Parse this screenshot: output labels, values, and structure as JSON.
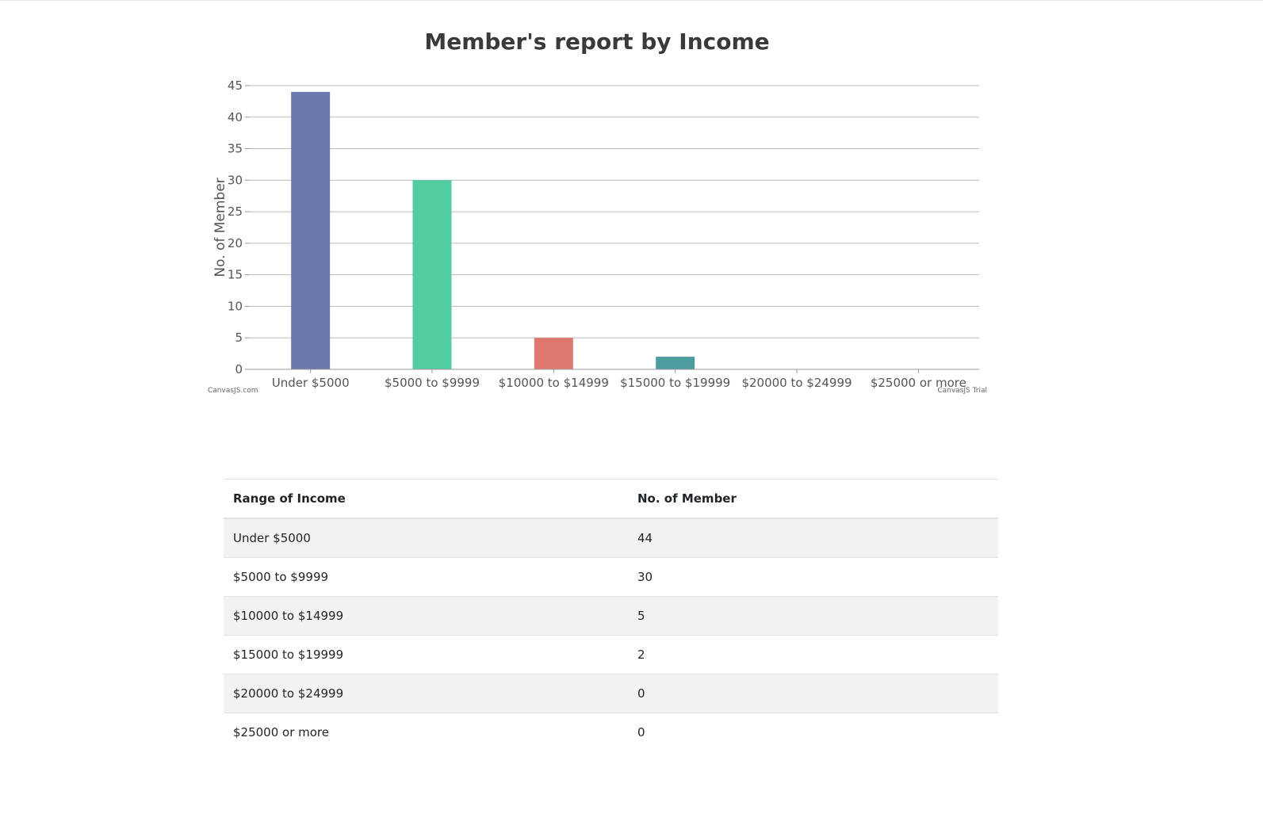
{
  "chart_data": {
    "type": "bar",
    "title": "Member's report by Income",
    "ylabel": "No. of Member",
    "xlabel": "",
    "categories": [
      "Under $5000",
      "$5000 to $9999",
      "$10000 to $14999",
      "$15000 to $19999",
      "$20000 to $24999",
      "$25000 or more"
    ],
    "values": [
      44,
      30,
      5,
      2,
      0,
      0
    ],
    "colors": [
      "#6d78ad",
      "#51cda0",
      "#df7970",
      "#4c9ca0",
      "#ae7d99",
      "#c9d45c"
    ],
    "ylim": [
      0,
      45
    ],
    "yticks": [
      0,
      5,
      10,
      15,
      20,
      25,
      30,
      35,
      40,
      45
    ],
    "grid": true,
    "grid_color": "#bbbbbb",
    "credit_left": "CanvasJS.com",
    "credit_right": "CanvasJS Trial"
  },
  "table": {
    "headers": [
      "Range of Income",
      "No. of Member"
    ],
    "rows": [
      [
        "Under $5000",
        "44"
      ],
      [
        "$5000 to $9999",
        "30"
      ],
      [
        "$10000 to $14999",
        "5"
      ],
      [
        "$15000 to $19999",
        "2"
      ],
      [
        "$20000 to $24999",
        "0"
      ],
      [
        "$25000 or more",
        "0"
      ]
    ]
  }
}
